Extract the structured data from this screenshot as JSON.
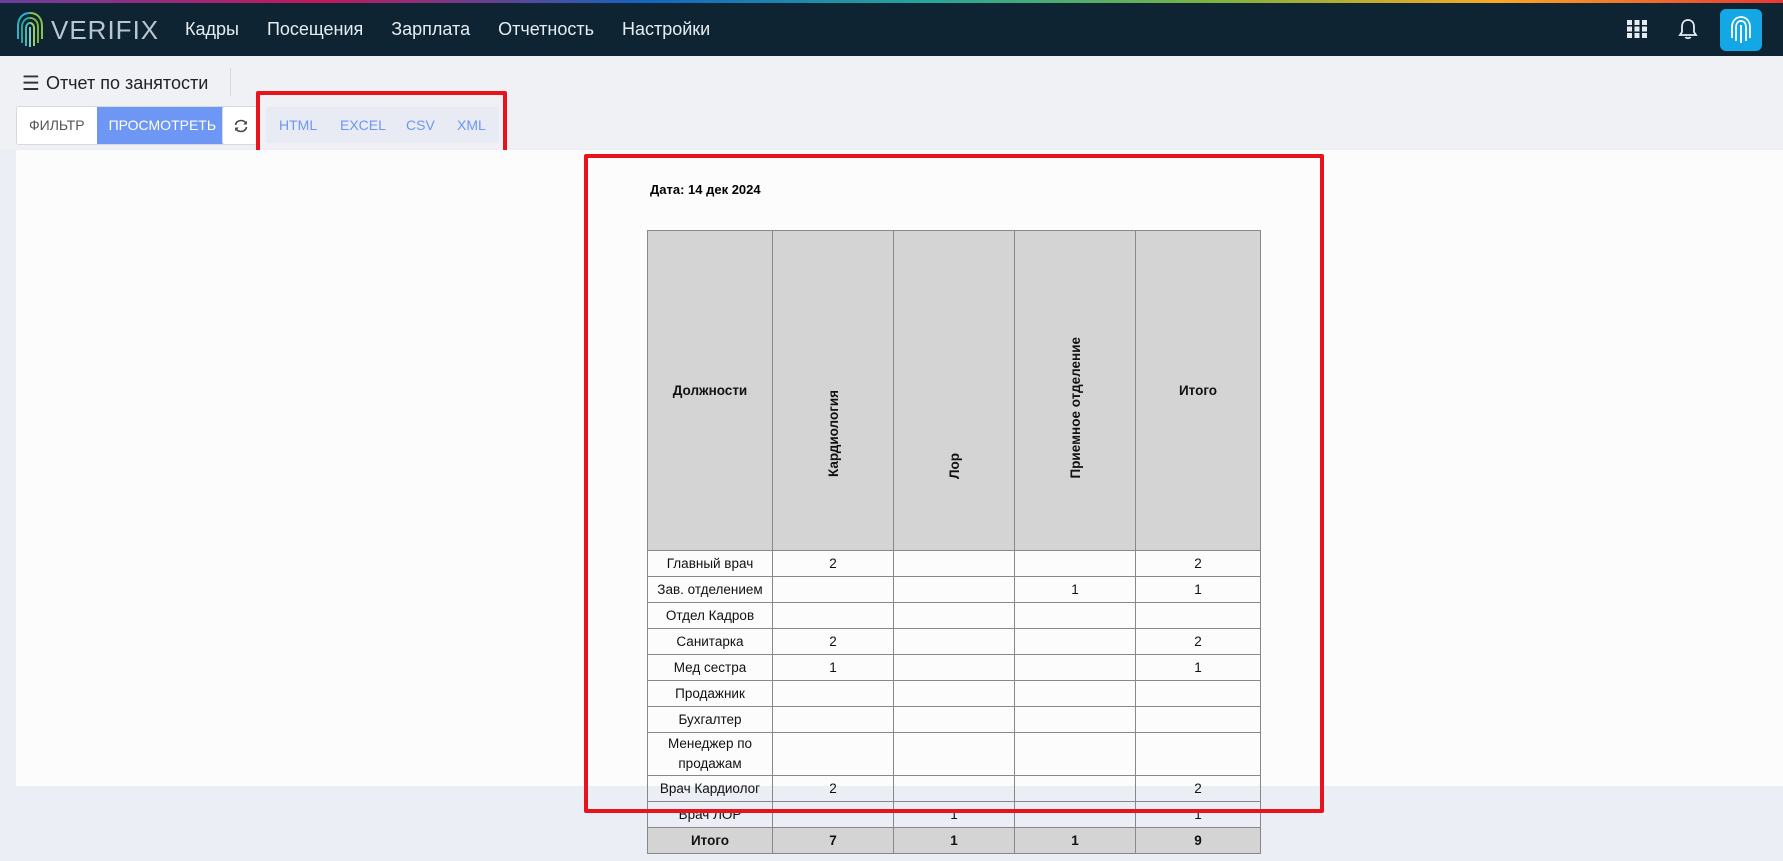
{
  "app": {
    "logo_text": "VERIFIX"
  },
  "nav": [
    {
      "label": "Кадры"
    },
    {
      "label": "Посещения"
    },
    {
      "label": "Зарплата"
    },
    {
      "label": "Отчетность"
    },
    {
      "label": "Настройки"
    }
  ],
  "header_icons": [
    "apps-grid-icon",
    "bell-icon",
    "fingerprint-avatar-icon"
  ],
  "page": {
    "title": "Отчет по занятости"
  },
  "toolbar": {
    "filter_label": "ФИЛЬТР",
    "view_label": "ПРОСМОТРЕТЬ",
    "refresh_icon": "refresh-icon",
    "exports": [
      "HTML",
      "EXCEL",
      "CSV",
      "XML"
    ]
  },
  "report": {
    "date_label": "Дата: 14 дек 2024",
    "columns": [
      "Должности",
      "Кардиология",
      "Лор",
      "Приемное отделение",
      "Итого"
    ],
    "rows": [
      [
        "Главный врач",
        "2",
        "",
        "",
        "2"
      ],
      [
        "Зав. отделением",
        "",
        "",
        "1",
        "1"
      ],
      [
        "Отдел Кадров",
        "",
        "",
        "",
        ""
      ],
      [
        "Санитарка",
        "2",
        "",
        "",
        "2"
      ],
      [
        "Мед сестра",
        "1",
        "",
        "",
        "1"
      ],
      [
        "Продажник",
        "",
        "",
        "",
        ""
      ],
      [
        "Бухгалтер",
        "",
        "",
        "",
        ""
      ],
      [
        "Менеджер по продажам",
        "",
        "",
        "",
        ""
      ],
      [
        "Врач Кардиолог",
        "2",
        "",
        "",
        "2"
      ],
      [
        "Врач ЛОР",
        "",
        "1",
        "",
        "1"
      ]
    ],
    "totals": [
      "Итого",
      "7",
      "1",
      "1",
      "9"
    ]
  },
  "colors": {
    "topbar": "#0e2433",
    "accent": "#6e96f5",
    "highlight": "#e8131b",
    "avatar": "#14a7e6"
  }
}
